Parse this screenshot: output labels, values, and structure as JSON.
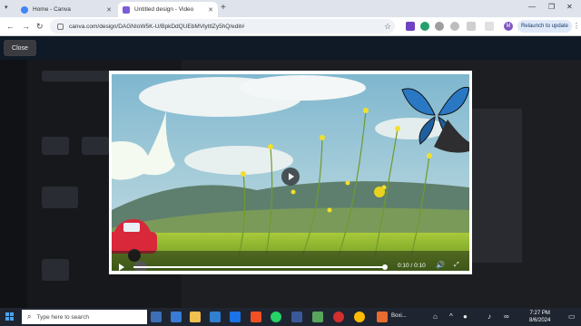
{
  "browser": {
    "tabs": [
      {
        "label": "Home - Canva",
        "favicon": "chrome-icon",
        "active": false
      },
      {
        "label": "Untitled design - Video",
        "favicon": "canva-video-icon",
        "active": true
      }
    ],
    "url": "canva.com/design/DAGNIoW5K-U/BpkDdQUEbMVlyttlZy5hQ/edit#",
    "relaunch_label": "Relaunch to update",
    "profile_initial": "M"
  },
  "modal": {
    "close_label": "Close",
    "time_display": "0:10 / 0:10",
    "progress": 1.0
  },
  "taskbar": {
    "search_placeholder": "Type here to search",
    "pinned_app_label": "Boxi...",
    "time": "7:27 PM",
    "date": "8/6/2024"
  },
  "colors": {
    "accent": "#7e57c2",
    "sky": "#9ec9d6",
    "grass": "#8fbf2a",
    "butterfly": "#2a78c4",
    "car": "#d8283a"
  }
}
